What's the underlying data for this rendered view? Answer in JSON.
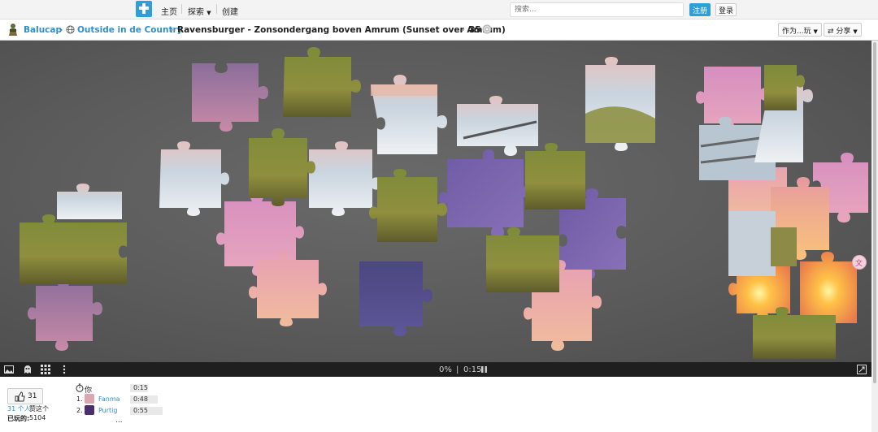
{
  "nav": {
    "home": "主页",
    "explore": "探索",
    "create": "创建",
    "search_placeholder": "搜索...",
    "signup": "注册",
    "login": "登录"
  },
  "breadcrumb": {
    "user": "Balucap",
    "category": "Outside in de Country",
    "puzzle_title": "Ravensburger - Zonsondergang boven Amrum (Sunset over Amrum)",
    "piece_count": "35",
    "play_as": "作为...玩",
    "share": "分享"
  },
  "game": {
    "progress": "0%",
    "separator": "|",
    "timer": "0:15",
    "pieces_total": 35,
    "pieces_placed": 0
  },
  "footer": {
    "likes": "31",
    "likes_text_count": "31 个人",
    "likes_text_rest": "赞这个",
    "played_label": "已玩的:",
    "played_count": "5104",
    "you_label": "你",
    "you_time": "0:15",
    "leaderboard": [
      {
        "rank": "1.",
        "name": "Fanma",
        "time": "0:48"
      },
      {
        "rank": "2.",
        "name": "Purtig",
        "time": "0:55"
      }
    ],
    "more": "..."
  },
  "colors": {
    "accent": "#2e9fd8",
    "link": "#2e8fcf",
    "board": "#5e5e5e",
    "toolbar": "#1f1f1f"
  },
  "icons": [
    "puzzle-logo-icon",
    "caret-down-icon",
    "globe-icon",
    "gear-icon",
    "image-preview-icon",
    "ghost-icon",
    "grid-icon",
    "more-icon",
    "fullscreen-icon",
    "pause-icon",
    "thumbs-up-icon",
    "stopwatch-icon",
    "translate-icon"
  ]
}
